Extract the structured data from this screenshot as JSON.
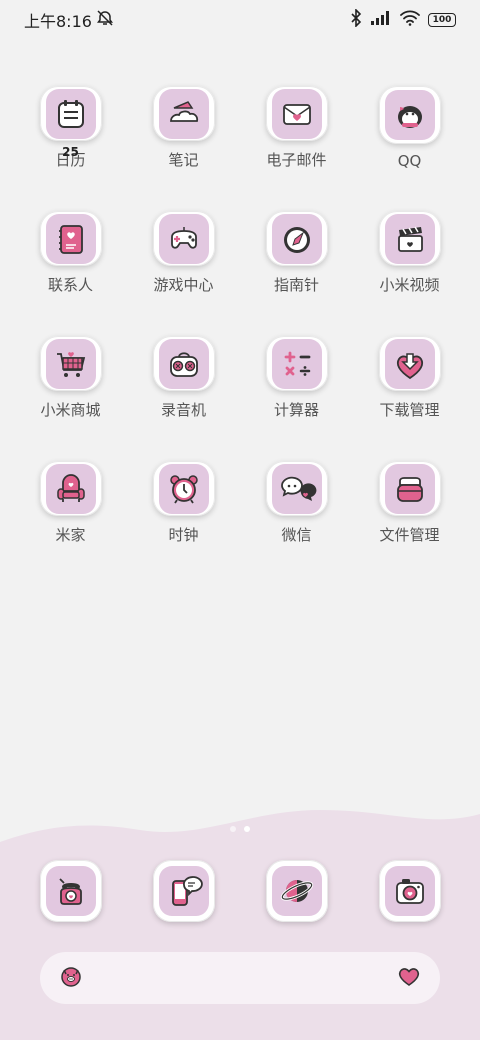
{
  "status_bar": {
    "time": "上午8:16",
    "battery": "100",
    "icons": [
      "alarm-off-icon",
      "bluetooth-icon",
      "signal-icon",
      "wifi-icon",
      "battery-icon"
    ]
  },
  "apps": [
    {
      "label": "日历",
      "icon": "calendar-icon",
      "badge": "25"
    },
    {
      "label": "笔记",
      "icon": "notes-icon"
    },
    {
      "label": "电子邮件",
      "icon": "mail-icon"
    },
    {
      "label": "QQ",
      "icon": "penguin-icon"
    },
    {
      "label": "联系人",
      "icon": "contacts-icon"
    },
    {
      "label": "游戏中心",
      "icon": "gamepad-icon"
    },
    {
      "label": "指南针",
      "icon": "compass-icon"
    },
    {
      "label": "小米视频",
      "icon": "clapperboard-icon"
    },
    {
      "label": "小米商城",
      "icon": "shopping-cart-icon"
    },
    {
      "label": "录音机",
      "icon": "radio-icon"
    },
    {
      "label": "计算器",
      "icon": "calculator-icon"
    },
    {
      "label": "下载管理",
      "icon": "download-heart-icon"
    },
    {
      "label": "米家",
      "icon": "armchair-icon"
    },
    {
      "label": "时钟",
      "icon": "alarm-clock-icon"
    },
    {
      "label": "微信",
      "icon": "chat-bubble-icon"
    },
    {
      "label": "文件管理",
      "icon": "folder-bag-icon"
    }
  ],
  "dock": [
    {
      "icon": "telephone-icon"
    },
    {
      "icon": "message-phone-icon"
    },
    {
      "icon": "planet-browser-icon"
    },
    {
      "icon": "camera-icon"
    }
  ],
  "search_bar": {
    "left_icon": "pig-icon",
    "right_icon": "heart-icon"
  },
  "page_indicator": {
    "pages": 2,
    "active": 2
  },
  "colors": {
    "background": "#f2f2f2",
    "tile_inner": "#e2c8e0",
    "accent_pink": "#e0628e",
    "dock_bg": "#ecdfe9"
  }
}
